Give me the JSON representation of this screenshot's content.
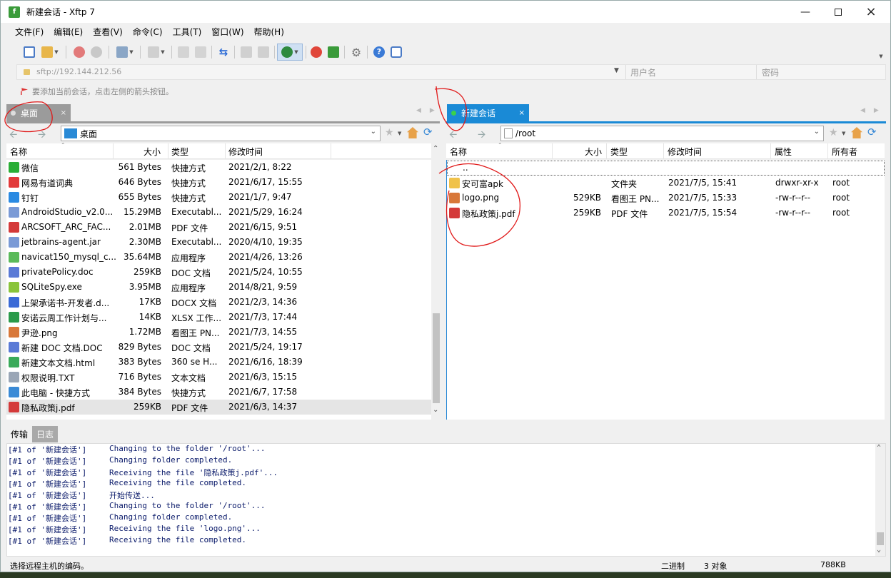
{
  "window": {
    "title": "新建会话 - Xftp 7",
    "app_icon": "xftp-icon"
  },
  "menu": [
    "文件(F)",
    "编辑(E)",
    "查看(V)",
    "命令(C)",
    "工具(T)",
    "窗口(W)",
    "帮助(H)"
  ],
  "address": {
    "url": "sftp://192.144.212.56",
    "user_placeholder": "用户名",
    "pass_placeholder": "密码"
  },
  "hint": "要添加当前会话，点击左侧的箭头按钮。",
  "left": {
    "tab": "桌面",
    "path": "桌面",
    "columns": [
      "名称",
      "大小",
      "类型",
      "修改时间"
    ],
    "rows": [
      {
        "name": "微信",
        "size": "561 Bytes",
        "type": "快捷方式",
        "time": "2021/2/1, 8:22",
        "icon": "wechat",
        "color": "#2aae36"
      },
      {
        "name": "网易有道词典",
        "size": "646 Bytes",
        "type": "快捷方式",
        "time": "2021/6/17, 15:55",
        "icon": "youdao",
        "color": "#e23a3a"
      },
      {
        "name": "钉钉",
        "size": "655 Bytes",
        "type": "快捷方式",
        "time": "2021/1/7, 9:47",
        "icon": "dingtalk",
        "color": "#2a8ae2"
      },
      {
        "name": "AndroidStudio_v2.0...",
        "size": "15.29MB",
        "type": "Executabl...",
        "time": "2021/5/29, 16:24",
        "icon": "exe",
        "color": "#7a9ad6"
      },
      {
        "name": "ARCSOFT_ARC_FAC...",
        "size": "2.01MB",
        "type": "PDF 文件",
        "time": "2021/6/15, 9:51",
        "icon": "pdf",
        "color": "#d43a3a"
      },
      {
        "name": "jetbrains-agent.jar",
        "size": "2.30MB",
        "type": "Executabl...",
        "time": "2020/4/10, 19:35",
        "icon": "jar",
        "color": "#7a9ad6"
      },
      {
        "name": "navicat150_mysql_c...",
        "size": "35.64MB",
        "type": "应用程序",
        "time": "2021/4/26, 13:26",
        "icon": "navicat",
        "color": "#5aba5a"
      },
      {
        "name": "privatePolicy.doc",
        "size": "259KB",
        "type": "DOC 文档",
        "time": "2021/5/24, 10:55",
        "icon": "doc",
        "color": "#5a7ad6"
      },
      {
        "name": "SQLiteSpy.exe",
        "size": "3.95MB",
        "type": "应用程序",
        "time": "2014/8/21, 9:59",
        "icon": "sqlite",
        "color": "#8ac43a"
      },
      {
        "name": "上架承诺书-开发者.d...",
        "size": "17KB",
        "type": "DOCX 文档",
        "time": "2021/2/3, 14:36",
        "icon": "docx",
        "color": "#3a6ad6"
      },
      {
        "name": "安诺云周工作计划与...",
        "size": "14KB",
        "type": "XLSX 工作...",
        "time": "2021/7/3, 17:44",
        "icon": "xlsx",
        "color": "#2a9a4a"
      },
      {
        "name": "尹逊.png",
        "size": "1.72MB",
        "type": "看图王 PN...",
        "time": "2021/7/3, 14:55",
        "icon": "png",
        "color": "#d8783a"
      },
      {
        "name": "新建 DOC 文档.DOC",
        "size": "829 Bytes",
        "type": "DOC 文档",
        "time": "2021/5/24, 19:17",
        "icon": "doc",
        "color": "#5a7ad6"
      },
      {
        "name": "新建文本文档.html",
        "size": "383 Bytes",
        "type": "360 se H...",
        "time": "2021/6/16, 18:39",
        "icon": "html",
        "color": "#3aaa5a"
      },
      {
        "name": "权限说明.TXT",
        "size": "716 Bytes",
        "type": "文本文档",
        "time": "2021/6/3, 15:15",
        "icon": "txt",
        "color": "#9aa6b6"
      },
      {
        "name": "此电脑 - 快捷方式",
        "size": "384 Bytes",
        "type": "快捷方式",
        "time": "2021/6/7, 17:58",
        "icon": "computer",
        "color": "#3a8ad6"
      },
      {
        "name": "隐私政策j.pdf",
        "size": "259KB",
        "type": "PDF 文件",
        "time": "2021/6/3, 14:37",
        "icon": "pdf",
        "color": "#d43a3a"
      }
    ]
  },
  "right": {
    "tab": "新建会话",
    "path": "/root",
    "columns": [
      "名称",
      "大小",
      "类型",
      "修改时间",
      "属性",
      "所有者"
    ],
    "parent": "..",
    "rows": [
      {
        "name": "安可富apk",
        "size": "",
        "type": "文件夹",
        "time": "2021/7/5, 15:41",
        "attr": "drwxr-xr-x",
        "owner": "root",
        "icon": "folder",
        "color": "#f0c24a"
      },
      {
        "name": "logo.png",
        "size": "529KB",
        "type": "看图王 PN...",
        "time": "2021/7/5, 15:33",
        "attr": "-rw-r--r--",
        "owner": "root",
        "icon": "png",
        "color": "#d8783a"
      },
      {
        "name": "隐私政策j.pdf",
        "size": "259KB",
        "type": "PDF 文件",
        "time": "2021/7/5, 15:54",
        "attr": "-rw-r--r--",
        "owner": "root",
        "icon": "pdf",
        "color": "#d43a3a"
      }
    ]
  },
  "log": {
    "tabs": [
      "传输",
      "日志"
    ],
    "lines": [
      {
        "src": "[#1 of '新建会话']",
        "msg": "Changing to the folder '/root'..."
      },
      {
        "src": "[#1 of '新建会话']",
        "msg": "Changing folder completed."
      },
      {
        "src": "[#1 of '新建会话']",
        "msg": "Receiving the file '隐私政策j.pdf'..."
      },
      {
        "src": "[#1 of '新建会话']",
        "msg": "Receiving the file completed."
      },
      {
        "src": "[#1 of '新建会话']",
        "msg": "开始传送..."
      },
      {
        "src": "[#1 of '新建会话']",
        "msg": "Changing to the folder '/root'..."
      },
      {
        "src": "[#1 of '新建会话']",
        "msg": "Changing folder completed."
      },
      {
        "src": "[#1 of '新建会话']",
        "msg": "Receiving the file 'logo.png'..."
      },
      {
        "src": "[#1 of '新建会话']",
        "msg": "Receiving the file completed."
      }
    ]
  },
  "status": {
    "left": "选择远程主机的编码。",
    "mode": "二进制",
    "count": "3 对象",
    "size": "788KB"
  }
}
